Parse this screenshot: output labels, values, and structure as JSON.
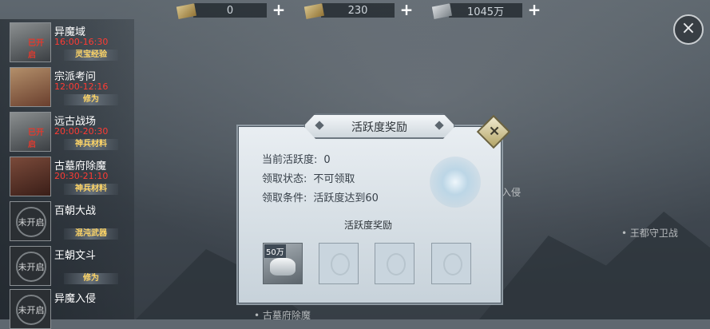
{
  "currencies": [
    {
      "icon": "gold-ingot-icon",
      "value": "0"
    },
    {
      "icon": "treasure-icon",
      "value": "230"
    },
    {
      "icon": "silver-ingot-icon",
      "value": "1045万"
    }
  ],
  "plus_symbol": "+",
  "close_symbol": "×",
  "events": [
    {
      "name": "异魔域",
      "time": "16:00-16:30",
      "reward": "灵宝经验",
      "tag": "已开启",
      "locked": false
    },
    {
      "name": "宗派考问",
      "time": "12:00-12:16",
      "reward": "修为",
      "tag": "",
      "locked": false
    },
    {
      "name": "远古战场",
      "time": "20:00-20:30",
      "reward": "神兵材料",
      "tag": "已开启",
      "locked": false
    },
    {
      "name": "古墓府除魔",
      "time": "20:30-21:10",
      "reward": "神兵材料",
      "tag": "",
      "locked": false
    },
    {
      "name": "百朝大战",
      "time": "",
      "reward": "混沌武器",
      "tag": "",
      "locked": true,
      "lock_text": "未开启"
    },
    {
      "name": "王朝文斗",
      "time": "",
      "reward": "修为",
      "tag": "",
      "locked": true,
      "lock_text": "未开启"
    },
    {
      "name": "异魔入侵",
      "time": "",
      "reward": "",
      "tag": "",
      "locked": true,
      "lock_text": "未开启"
    }
  ],
  "background_labels": {
    "invade": "入侵",
    "capital": "• 王都守卫战",
    "bottom": "• 古墓府除魔"
  },
  "dialog": {
    "title": "活跃度奖励",
    "rows": [
      {
        "label": "当前活跃度:",
        "value": "0"
      },
      {
        "label": "领取状态:",
        "value": "不可领取"
      },
      {
        "label": "领取条件:",
        "value": "活跃度达到60"
      }
    ],
    "reward_title": "活跃度奖励",
    "reward_slots": [
      {
        "amount": "50万",
        "icon": "silver-ingot-icon",
        "filled": true
      },
      {
        "amount": "",
        "icon": "empty-slot-icon",
        "filled": false
      },
      {
        "amount": "",
        "icon": "empty-slot-icon",
        "filled": false
      },
      {
        "amount": "",
        "icon": "empty-slot-icon",
        "filled": false
      }
    ]
  }
}
